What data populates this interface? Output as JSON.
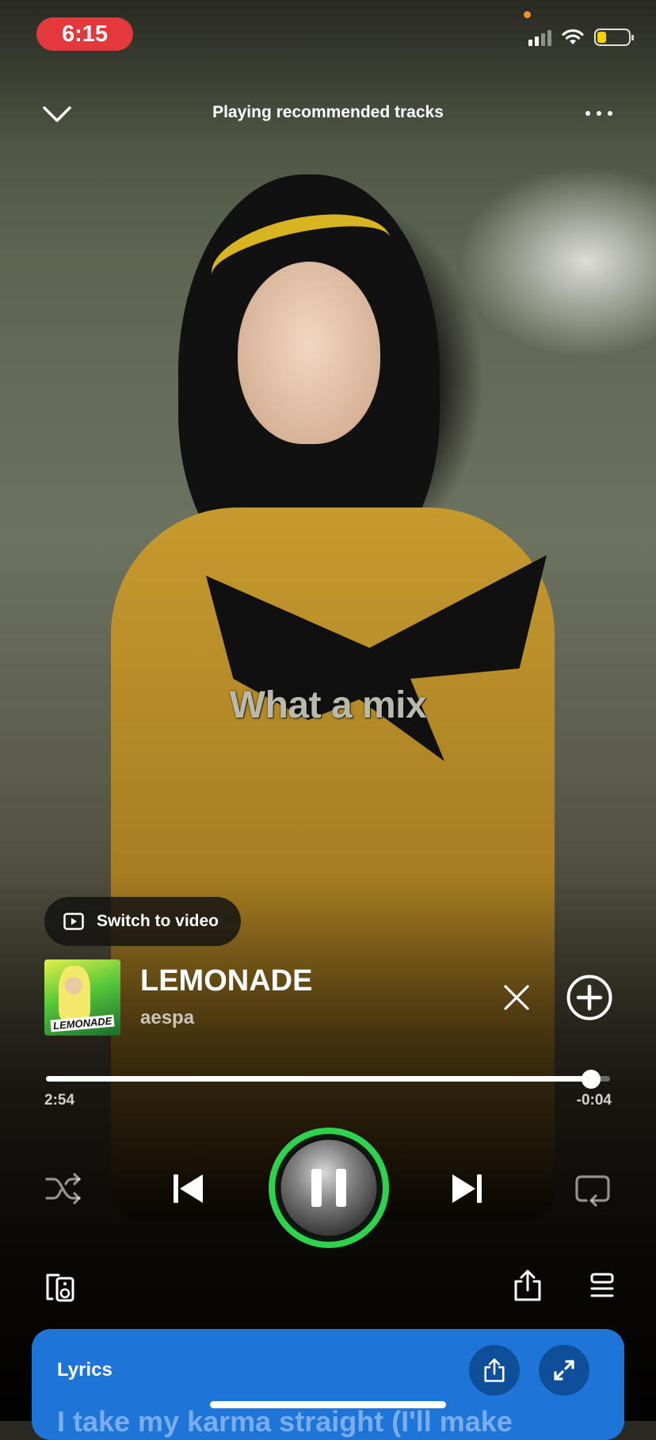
{
  "status_bar": {
    "time": "6:15",
    "signal_icon": "cellular-signal-icon",
    "wifi_icon": "wifi-icon",
    "battery_icon": "battery-icon",
    "battery_level": 0.3,
    "battery_color": "#f5d20c",
    "time_pill_color": "#e3393c"
  },
  "header": {
    "title": "Playing recommended tracks",
    "collapse_icon": "chevron-down-icon",
    "more_icon": "more-options-icon"
  },
  "video": {
    "lyric_overlay": "What a mix",
    "switch_label": "Switch to video",
    "switch_icon": "play-square-icon"
  },
  "track": {
    "title": "LEMONADE",
    "artist": "aespa",
    "album_art_word": "LEMONADE",
    "remove_icon": "close-icon",
    "add_icon": "plus-circle-icon"
  },
  "playback": {
    "elapsed": "2:54",
    "remaining": "-0:04",
    "progress": 0.966
  },
  "controls": {
    "shuffle_icon": "shuffle-icon",
    "previous_icon": "skip-previous-icon",
    "pause_icon": "pause-icon",
    "next_icon": "skip-next-icon",
    "repeat_icon": "repeat-icon",
    "accent_color": "#2ed24c"
  },
  "footer": {
    "devices_icon": "connect-device-icon",
    "share_icon": "share-icon",
    "queue_icon": "queue-icon"
  },
  "lyrics_card": {
    "title": "Lyrics",
    "first_line": "I take my karma straight (I'll make",
    "share_icon": "share-icon",
    "expand_icon": "expand-icon",
    "background_color": "#1f74d8"
  }
}
